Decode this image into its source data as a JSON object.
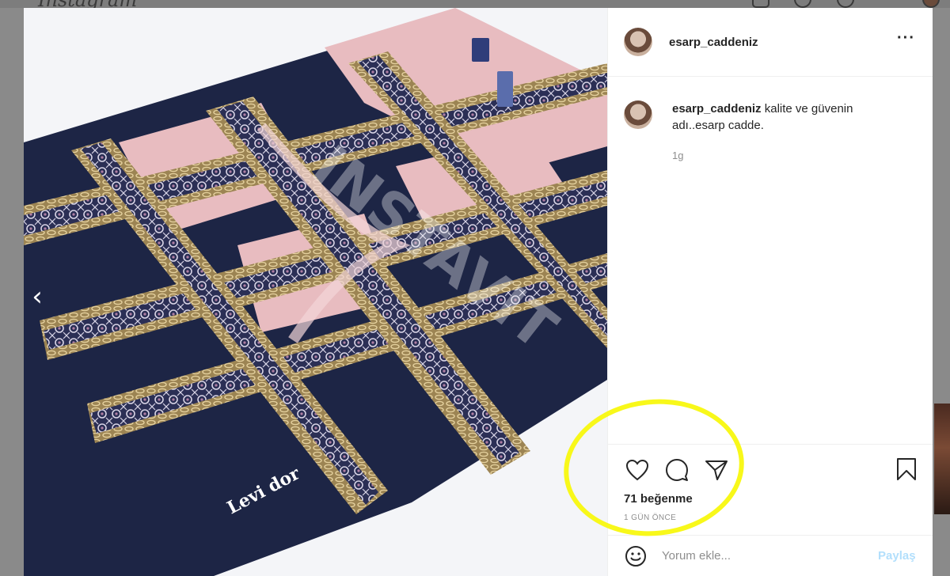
{
  "background": {
    "logo_text": "Instagram"
  },
  "post": {
    "username": "esarp_caddeniz",
    "caption_user": "esarp_caddeniz",
    "caption_text": " kalite ve güvenin adı..esarp cadde.",
    "caption_time": "1g",
    "likes": "71 beğenme",
    "time_ago": "1 GÜN ÖNCE",
    "product_brand_text": "Levi dor",
    "watermark_text": "INSTAVIT"
  },
  "comment": {
    "placeholder": "Yorum ekle...",
    "post_label": "Paylaş"
  },
  "icons": {
    "prev": "chevron-left-icon",
    "more": "more-options-icon",
    "like": "heart-icon",
    "comment": "comment-icon",
    "share": "send-icon",
    "save": "bookmark-icon",
    "emoji": "emoji-icon"
  },
  "colors": {
    "annotation": "#f8f81a",
    "scarf_navy": "#1d2545",
    "scarf_pink": "#e8bcc0",
    "scarf_gold": "#b69a5c",
    "post_button_disabled": "#b2dffc"
  }
}
